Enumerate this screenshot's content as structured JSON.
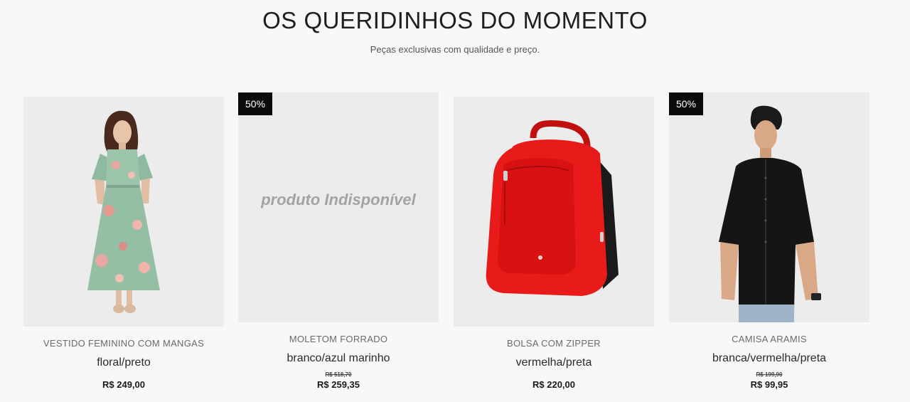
{
  "section": {
    "title": "OS QUERIDINHOS DO MOMENTO",
    "subtitle": "Peças exclusivas com qualidade e preço."
  },
  "products": [
    {
      "name": "VESTIDO FEMININO COM MANGAS",
      "variant": "floral/preto",
      "price": "R$ 249,00",
      "image": "floral-dress-photo"
    },
    {
      "badge": "50%",
      "unavailable_text": "produto Indisponível",
      "name": "MOLETOM FORRADO",
      "variant": "branco/azul marinho",
      "old_price": "R$ 518,70",
      "price": "R$ 259,35"
    },
    {
      "name": "BOLSA COM ZIPPER",
      "variant": "vermelha/preta",
      "price": "R$ 220,00",
      "image": "red-backpack-photo"
    },
    {
      "badge": "50%",
      "name": "CAMISA ARAMIS",
      "variant": "branca/vermelha/preta",
      "old_price": "R$ 199,90",
      "price": "R$ 99,95",
      "image": "black-shirt-model-photo"
    }
  ],
  "colors": {
    "background": "#f8f8f8",
    "card_bg": "#ececec",
    "badge_bg": "#0b0b0b",
    "backpack_red": "#e81a1a"
  }
}
